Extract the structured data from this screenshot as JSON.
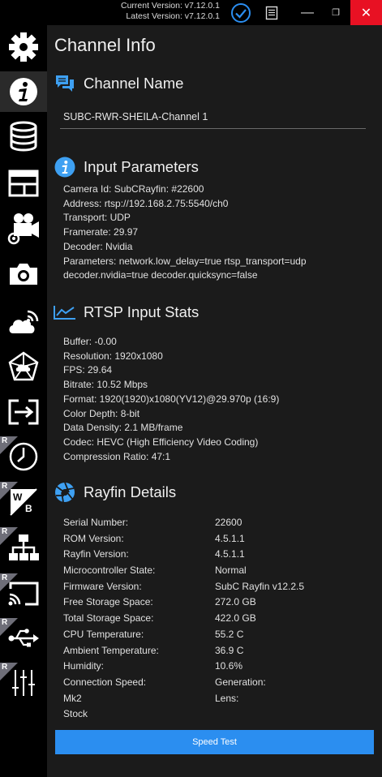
{
  "titlebar": {
    "current_version": "Current Version: v7.12.0.1",
    "latest_version": "Latest Version: v7.12.0.1",
    "minimize": "—",
    "maximize": "❐",
    "close": "✕"
  },
  "sidebar": {
    "items": [
      {
        "name": "settings",
        "icon": "gear-icon",
        "badge": ""
      },
      {
        "name": "channel-info",
        "icon": "info-icon",
        "badge": ""
      },
      {
        "name": "database",
        "icon": "database-icon",
        "badge": ""
      },
      {
        "name": "layout",
        "icon": "layout-icon",
        "badge": ""
      },
      {
        "name": "camera-settings",
        "icon": "video-camera-gear-icon",
        "badge": ""
      },
      {
        "name": "snapshot",
        "icon": "camera-icon",
        "badge": ""
      },
      {
        "name": "cloud-stream",
        "icon": "cloud-signal-icon",
        "badge": ""
      },
      {
        "name": "network-cloud",
        "icon": "network-cloud-icon",
        "badge": ""
      },
      {
        "name": "output",
        "icon": "export-icon",
        "badge": ""
      },
      {
        "name": "clock",
        "icon": "clock-icon",
        "badge": "R"
      },
      {
        "name": "white-balance",
        "icon": "white-balance-icon",
        "badge": "R"
      },
      {
        "name": "network",
        "icon": "network-icon",
        "badge": "R"
      },
      {
        "name": "cast",
        "icon": "cast-icon",
        "badge": "R"
      },
      {
        "name": "usb",
        "icon": "usb-icon",
        "badge": "R"
      },
      {
        "name": "adjustments",
        "icon": "sliders-icon",
        "badge": "R"
      }
    ]
  },
  "page_title": "Channel Info",
  "channel_name": {
    "heading": "Channel Name",
    "value": "SUBC-RWR-SHEILA-Channel 1"
  },
  "input_parameters": {
    "heading": "Input Parameters",
    "lines": [
      "Camera Id: SubCRayfin: #22600",
      "Address: rtsp://192.168.2.75:5540/ch0",
      "Transport: UDP",
      "Framerate: 29.97",
      "Decoder: Nvidia",
      "Parameters: network.low_delay=true rtsp_transport=udp",
      "decoder.nvidia=true decoder.quicksync=false"
    ]
  },
  "rtsp_stats": {
    "heading": "RTSP Input Stats",
    "lines": [
      "Buffer: -0.00",
      "Resolution: 1920x1080",
      "FPS: 29.64",
      "Bitrate: 10.52 Mbps",
      "Format: 1920(1920)x1080(YV12)@29.970p (16:9)",
      "Color Depth: 8-bit",
      "Data Density: 2.1 MB/frame",
      "Codec: HEVC (High Efficiency Video Coding)",
      "Compression Ratio: 47:1"
    ]
  },
  "rayfin_details": {
    "heading": "Rayfin Details",
    "rows": [
      {
        "label": "Serial Number:",
        "value": "22600"
      },
      {
        "label": "ROM Version:",
        "value": "4.5.1.1"
      },
      {
        "label": "Rayfin Version:",
        "value": "4.5.1.1"
      },
      {
        "label": "Microcontroller State:",
        "value": "Normal"
      },
      {
        "label": "Firmware Version:",
        "value": "SubC Rayfin v12.2.5"
      },
      {
        "label": "Free Storage Space:",
        "value": "272.0 GB"
      },
      {
        "label": "Total Storage Space:",
        "value": "422.0 GB"
      },
      {
        "label": "CPU Temperature:",
        "value": "55.2 C"
      },
      {
        "label": "Ambient Temperature:",
        "value": "36.9 C"
      },
      {
        "label": "Humidity:",
        "value": "10.6%"
      },
      {
        "label": "Connection Speed:",
        "value": "Generation:"
      },
      {
        "label": "Mk2",
        "value": "Lens:"
      },
      {
        "label": "Stock",
        "value": ""
      }
    ]
  },
  "speed_test_label": "Speed Test",
  "colors": {
    "accent": "#2b8ef0",
    "icon_blue": "#3ea0f2",
    "close": "#e81123"
  }
}
